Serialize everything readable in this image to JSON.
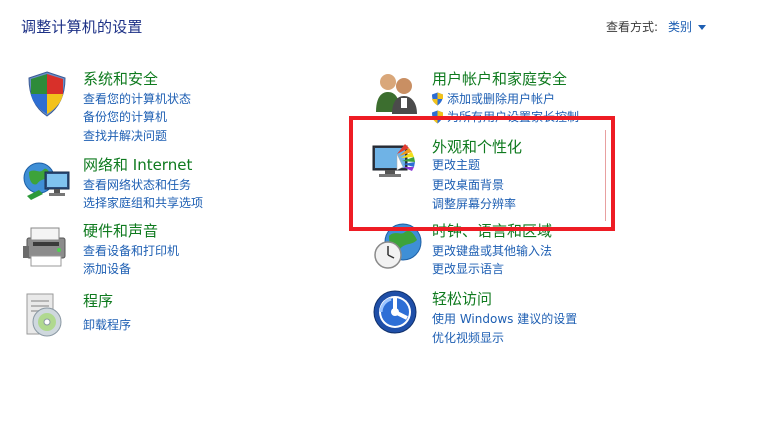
{
  "header": {
    "title": "调整计算机的设置",
    "view_by_label": "查看方式:",
    "view_by_value": "类别"
  },
  "categories": {
    "system": {
      "title": "系统和安全",
      "icon": "system-security-icon",
      "links": [
        "查看您的计算机状态",
        "备份您的计算机",
        "查找并解决问题"
      ]
    },
    "network": {
      "title": "网络和 Internet",
      "icon": "network-globe-icon",
      "links": [
        "查看网络状态和任务",
        "选择家庭组和共享选项"
      ]
    },
    "hardware": {
      "title": "硬件和声音",
      "icon": "printer-icon",
      "links": [
        "查看设备和打印机",
        "添加设备"
      ]
    },
    "programs": {
      "title": "程序",
      "icon": "programs-disc-icon",
      "links": [
        "卸载程序"
      ]
    },
    "users": {
      "title": "用户帐户和家庭安全",
      "icon": "users-icon",
      "links": [
        "添加或删除用户帐户",
        "为所有用户设置家长控制"
      ]
    },
    "appearance": {
      "title": "外观和个性化",
      "icon": "monitor-palette-icon",
      "links": [
        "更改主题",
        "更改桌面背景",
        "调整屏幕分辨率"
      ]
    },
    "clock": {
      "title": "时钟、语言和区域",
      "icon": "clock-globe-icon",
      "links": [
        "更改键盘或其他输入法",
        "更改显示语言"
      ]
    },
    "ease": {
      "title": "轻松访问",
      "icon": "ease-of-access-icon",
      "links": [
        "使用 Windows 建议的设置",
        "优化视频显示"
      ]
    }
  },
  "colors": {
    "title_blue": "#1e3287",
    "category_green": "#0e7a1e",
    "link_blue": "#1e5fb3",
    "highlight_red": "#ee1c24"
  }
}
